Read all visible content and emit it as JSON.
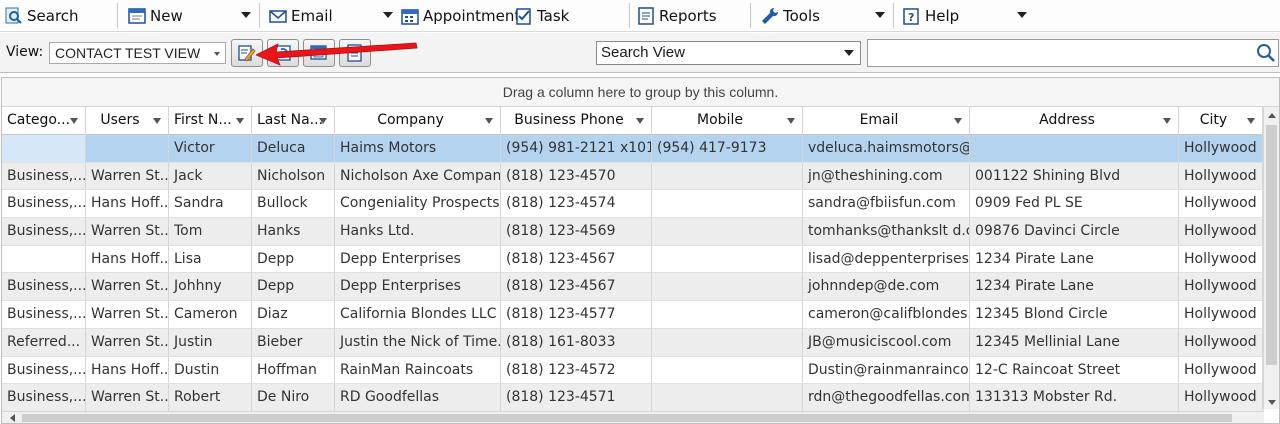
{
  "toolbar": {
    "items": [
      {
        "label": "Search",
        "icon": "search-icon"
      },
      {
        "label": "New",
        "icon": "new-icon"
      },
      {
        "label": "Email",
        "icon": "email-icon"
      },
      {
        "label": "Appointment",
        "icon": "calendar-icon"
      },
      {
        "label": "Task",
        "icon": "task-icon"
      },
      {
        "label": "Reports",
        "icon": "reports-icon"
      },
      {
        "label": "Tools",
        "icon": "wrench-icon"
      },
      {
        "label": "Help",
        "icon": "help-icon"
      }
    ]
  },
  "viewbar": {
    "view_label": "View:",
    "view_value": "CONTACT TEST VIEW",
    "search_view_value": "Search View",
    "search_value": "",
    "arrow_color": "#e8161b"
  },
  "grid": {
    "group_prompt": "Drag a column here to group by this column.",
    "columns": [
      "Catego...",
      "Users",
      "First N...",
      "Last Na...",
      "Company",
      "Business Phone",
      "Mobile",
      "Email",
      "Address",
      "City"
    ],
    "rows": [
      [
        "",
        "",
        "Victor",
        "Deluca",
        "Haims Motors",
        "(954) 981-2121 x101",
        "(954) 417-9173",
        "vdeluca.haimsmotors@...",
        "",
        "Hollywood"
      ],
      [
        "Business,...",
        "Warren St...",
        "Jack",
        "Nicholson",
        "Nicholson Axe Company",
        "(818) 123-4570",
        "",
        "jn@theshining.com",
        "001122 Shining Blvd",
        "Hollywood"
      ],
      [
        "Business,...",
        "Hans Hoff...",
        "Sandra",
        "Bullock",
        "Congeniality Prospects",
        "(818) 123-4574",
        "",
        "sandra@fbiisfun.com",
        "0909 Fed PL SE",
        "Hollywood"
      ],
      [
        "Business,...",
        "Warren St...",
        "Tom",
        "Hanks",
        "Hanks Ltd.",
        "(818) 123-4569",
        "",
        "tomhanks@thankslt d.c...",
        "09876 Davinci Circle",
        "Hollywood"
      ],
      [
        "",
        "Hans Hoff...",
        "Lisa",
        "Depp",
        "Depp Enterprises",
        "(818) 123-4567",
        "",
        "lisad@deppenterprises....",
        "1234 Pirate Lane",
        "Hollywood"
      ],
      [
        "Business,...",
        "Warren St...",
        "Johhny",
        "Depp",
        "Depp Enterprises",
        "(818) 123-4567",
        "",
        "johnndep@de.com",
        "1234 Pirate Lane",
        "Hollywood"
      ],
      [
        "Business,...",
        "Warren St...",
        "Cameron",
        "Diaz",
        "California Blondes LLC",
        "(818) 123-4577",
        "",
        "cameron@califblondes....",
        "12345 Blond Circle",
        "Hollywood"
      ],
      [
        "Referred...",
        "Warren St...",
        "Justin",
        "Bieber",
        "Justin the Nick of Time...",
        "(818) 161-8033",
        "",
        "JB@musiciscool.com",
        "12345 Mellinial Lane",
        "Hollywood"
      ],
      [
        "Business,...",
        "Hans Hoff...",
        "Dustin",
        "Hoffman",
        "RainMan Raincoats",
        "(818) 123-4572",
        "",
        "Dustin@rainmanrainco...",
        "12-C Raincoat Street",
        "Hollywood"
      ],
      [
        "Business,...",
        "Warren St...",
        "Robert",
        "De Niro",
        "RD Goodfellas",
        "(818) 123-4571",
        "",
        "rdn@thegoodfellas.com",
        "131313 Mobster Rd.",
        "Hollywood"
      ]
    ]
  }
}
